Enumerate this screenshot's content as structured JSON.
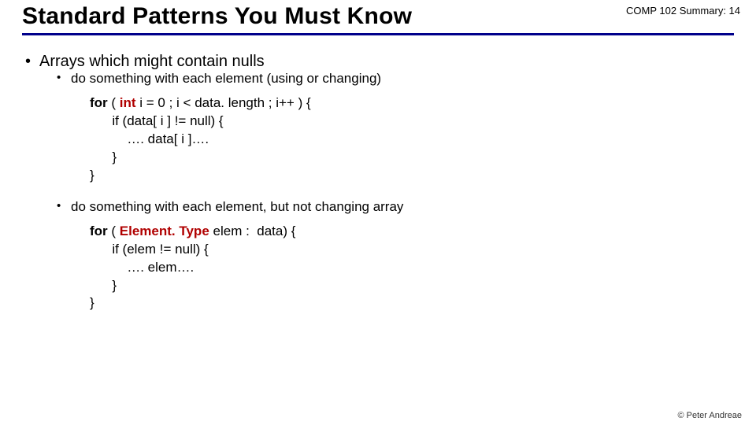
{
  "header": {
    "title": "Standard Patterns You Must Know",
    "course_tag": "COMP 102  Summary: 14"
  },
  "bullets": {
    "b1": "Arrays which might contain nulls",
    "b1a": "do something with each element (using or changing)",
    "b1b": "do something with each element, but not changing array"
  },
  "code1": {
    "l1_for": "for",
    "l1_open": " ( ",
    "l1_int": "int",
    "l1_rest": " i = 0 ; i < data. length ; i++ ) {",
    "l2": "      if (data[ i ] != null) {",
    "l3": "          …. data[ i ]…. ",
    "l4": "      }",
    "l5": "}"
  },
  "code2": {
    "l1_for": "for",
    "l1_open": " ( ",
    "l1_type": "Element. Type",
    "l1_rest": " elem :  data) {",
    "l2": "      if (elem != null) {",
    "l3": "          …. elem…. ",
    "l4": "      }",
    "l5": "}"
  },
  "footer": "© Peter Andreae"
}
